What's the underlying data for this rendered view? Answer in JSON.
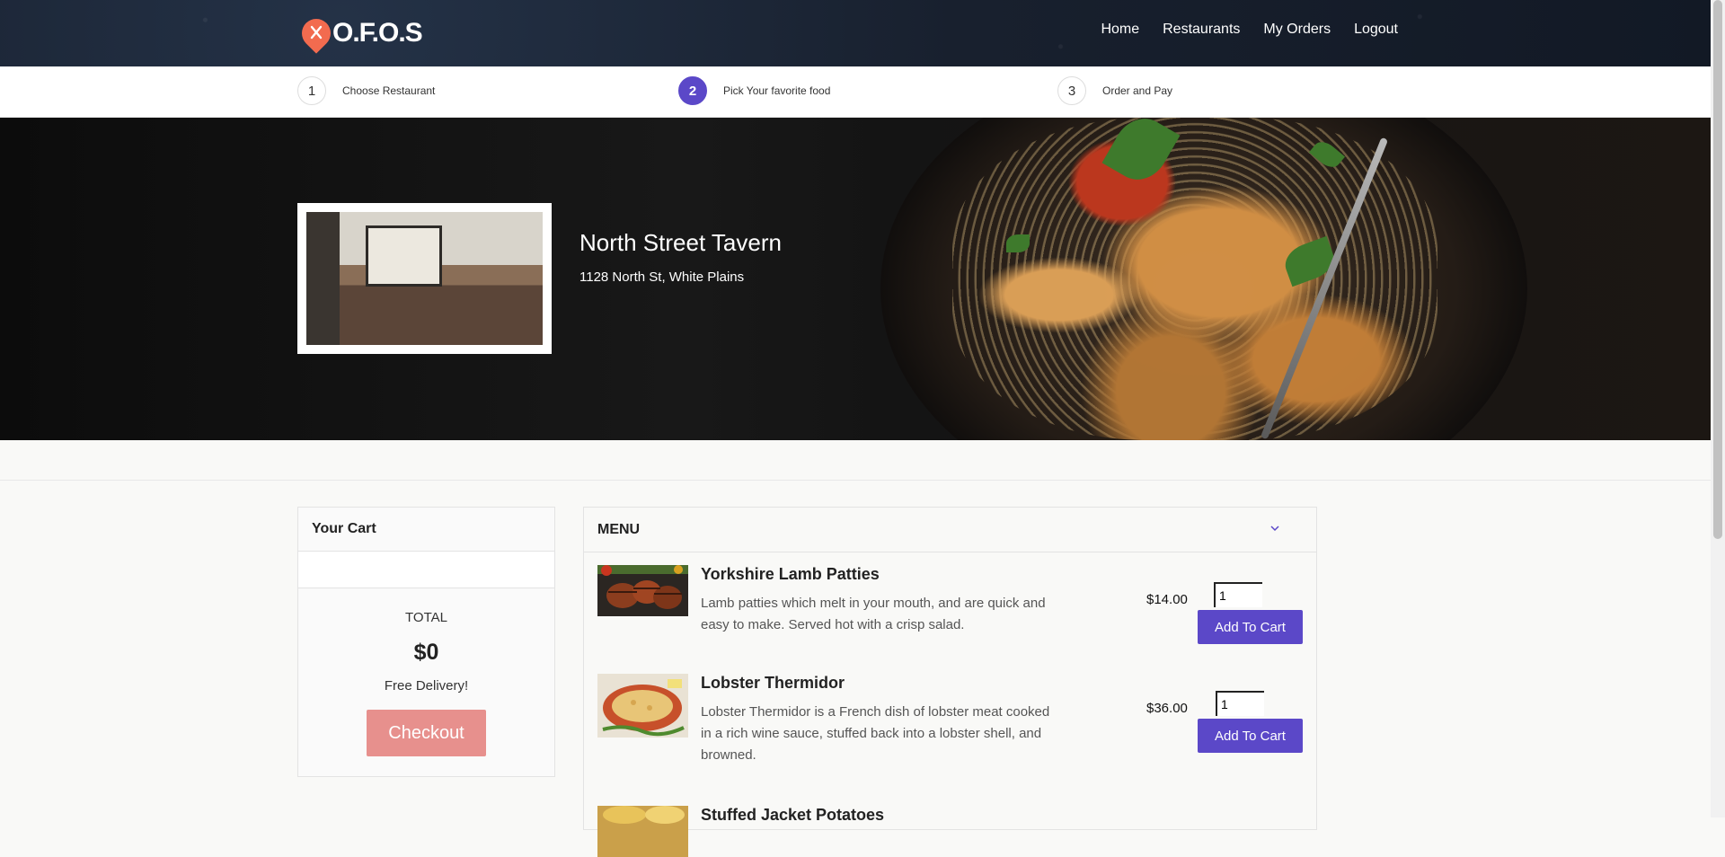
{
  "brand": {
    "name": "O.F.O.S",
    "accent": "#f26b4f"
  },
  "nav": {
    "home": "Home",
    "restaurants": "Restaurants",
    "my_orders": "My Orders",
    "logout": "Logout"
  },
  "steps": [
    {
      "num": "1",
      "label": "Choose Restaurant",
      "active": false
    },
    {
      "num": "2",
      "label": "Pick Your favorite food",
      "active": true
    },
    {
      "num": "3",
      "label": "Order and Pay",
      "active": false
    }
  ],
  "restaurant": {
    "name": "North Street Tavern",
    "address": "1128 North St, White Plains"
  },
  "cart": {
    "title": "Your Cart",
    "total_label": "TOTAL",
    "total": "$0",
    "delivery": "Free Delivery!",
    "checkout_label": "Checkout"
  },
  "menu": {
    "title": "MENU",
    "items": [
      {
        "title": "Yorkshire Lamb Patties",
        "description": "Lamb patties which melt in your mouth, and are quick and easy to make. Served hot with a crisp salad.",
        "price": "$14.00",
        "qty": "1",
        "button": "Add To Cart"
      },
      {
        "title": "Lobster Thermidor",
        "description": "Lobster Thermidor is a French dish of lobster meat cooked in a rich wine sauce, stuffed back into a lobster shell, and browned.",
        "price": "$36.00",
        "qty": "1",
        "button": "Add To Cart"
      },
      {
        "title": "Stuffed Jacket Potatoes",
        "description": "",
        "price": "",
        "qty": "",
        "button": ""
      }
    ]
  },
  "colors": {
    "primary": "#5b48c8",
    "checkout": "#e7908d",
    "nav_bg": "#18202e"
  }
}
